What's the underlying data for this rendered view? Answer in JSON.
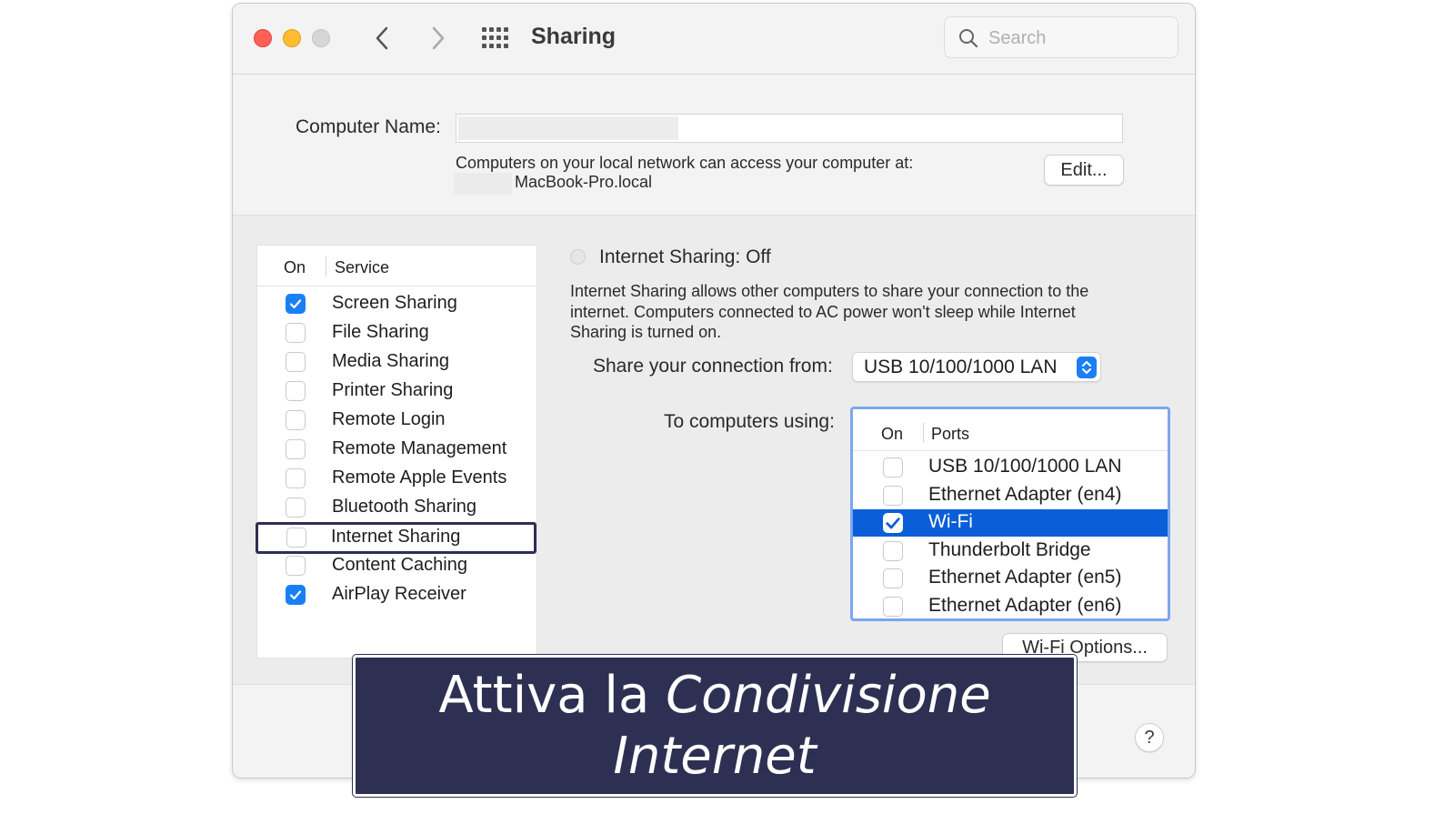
{
  "window": {
    "title": "Sharing",
    "search_placeholder": "Search"
  },
  "computer_name": {
    "label": "Computer Name:",
    "value": "",
    "info": "Computers on your local network can access your computer at:",
    "hostname": "MacBook-Pro.local",
    "edit_label": "Edit..."
  },
  "services": {
    "header_on": "On",
    "header_service": "Service",
    "items": [
      {
        "label": "Screen Sharing",
        "checked": true
      },
      {
        "label": "File Sharing",
        "checked": false
      },
      {
        "label": "Media Sharing",
        "checked": false
      },
      {
        "label": "Printer Sharing",
        "checked": false
      },
      {
        "label": "Remote Login",
        "checked": false
      },
      {
        "label": "Remote Management",
        "checked": false
      },
      {
        "label": "Remote Apple Events",
        "checked": false
      },
      {
        "label": "Bluetooth Sharing",
        "checked": false
      },
      {
        "label": "Internet Sharing",
        "checked": false,
        "highlighted": true
      },
      {
        "label": "Content Caching",
        "checked": false
      },
      {
        "label": "AirPlay Receiver",
        "checked": true
      }
    ]
  },
  "internet_sharing": {
    "status": "Internet Sharing: Off",
    "description": "Internet Sharing allows other computers to share your connection to the internet. Computers connected to AC power won't sleep while Internet Sharing is turned on.",
    "share_from_label": "Share your connection from:",
    "share_from_value": "USB 10/100/1000 LAN",
    "to_label": "To computers using:",
    "ports_header_on": "On",
    "ports_header_ports": "Ports",
    "ports": [
      {
        "label": "USB 10/100/1000 LAN",
        "checked": false
      },
      {
        "label": "Ethernet Adapter (en4)",
        "checked": false
      },
      {
        "label": "Wi-Fi",
        "checked": true,
        "selected": true
      },
      {
        "label": "Thunderbolt Bridge",
        "checked": false
      },
      {
        "label": "Ethernet Adapter (en5)",
        "checked": false
      },
      {
        "label": "Ethernet Adapter (en6)",
        "checked": false
      }
    ],
    "wifi_options_label": "Wi-Fi Options..."
  },
  "help_label": "?",
  "caption": {
    "line1_plain": "Attiva la ",
    "line1_italic": "Condivisione",
    "line2_italic": "Internet"
  },
  "colors": {
    "accent": "#1a7ff5",
    "selection": "#0a5ed7",
    "caption_bg": "#2d3052",
    "close": "#fe5f57",
    "minimize": "#febc2e"
  }
}
